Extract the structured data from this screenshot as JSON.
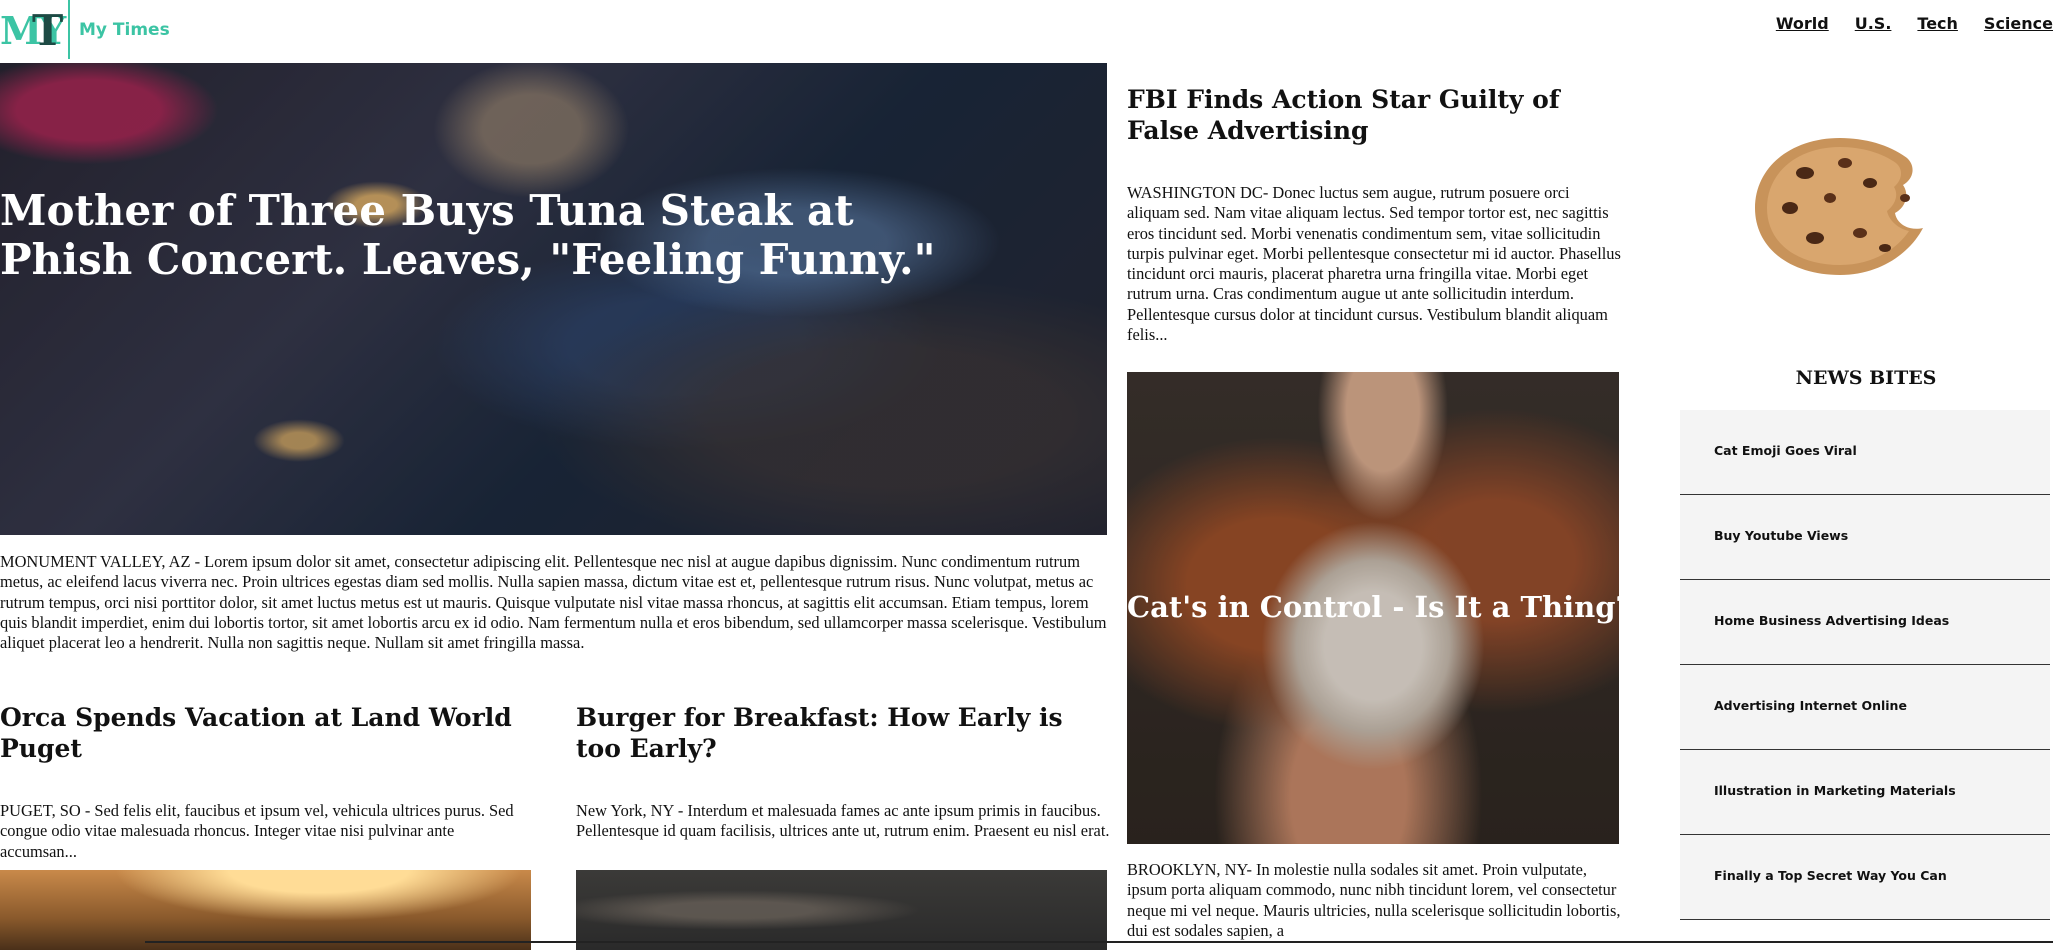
{
  "header": {
    "logo_text_m": "MY",
    "logo_text_t": "T",
    "site_name": "My Times",
    "nav": [
      "World",
      "U.S.",
      "Tech",
      "Science"
    ]
  },
  "hero": {
    "title": "Mother of Three Buys Tuna Steak at Phish Concert. Leaves, \"Feeling Funny.\"",
    "body": "MONUMENT VALLEY, AZ - Lorem ipsum dolor sit amet, consectetur adipiscing elit. Pellentesque nec nisl at augue dapibus dignissim. Nunc condimentum rutrum metus, ac eleifend lacus viverra nec. Proin ultrices egestas diam sed mollis. Nulla sapien massa, dictum vitae est et, pellentesque rutrum risus. Nunc volutpat, metus ac rutrum tempus, orci nisi porttitor dolor, sit amet luctus metus est ut mauris. Quisque vulputate nisl vitae massa rhoncus, at sagittis elit accumsan. Etiam tempus, lorem quis blandit imperdiet, enim dui lobortis tortor, sit amet lobortis arcu ex id odio. Nam fermentum nulla et eros bibendum, sed ullamcorper massa scelerisque. Vestibulum aliquet placerat leo a hendrerit. Nulla non sagittis neque. Nullam sit amet fringilla massa."
  },
  "articles": [
    {
      "title": "Orca Spends Vacation at Land World Puget",
      "body": "PUGET, SO - Sed felis elit, faucibus et ipsum vel, vehicula ultrices purus. Sed congue odio vitae malesuada rhoncus. Integer vitae nisi pulvinar ante accumsan..."
    },
    {
      "title": "Burger for Breakfast: How Early is too Early?",
      "body": "New York, NY - Interdum et malesuada fames ac ante ipsum primis in faucibus. Pellentesque id quam facilisis, ultrices ante ut, rutrum enim. Praesent eu nisl erat."
    }
  ],
  "middle": {
    "title": "FBI Finds Action Star Guilty of False Advertising",
    "body": "WASHINGTON DC- Donec luctus sem augue, rutrum posuere orci aliquam sed. Nam vitae aliquam lectus. Sed tempor tortor est, nec sagittis eros tincidunt sed. Morbi venenatis condimentum sem, vitae sollicitudin turpis pulvinar eget. Morbi pellentesque consectetur mi id auctor. Phasellus tincidunt orci mauris, placerat pharetra urna fringilla vitae. Morbi eget rutrum urna. Cras condimentum augue ut ante sollicitudin interdum. Pellentesque cursus dolor at tincidunt cursus. Vestibulum blandit aliquam felis...",
    "feature_title": "Cat's in Control - Is It a Thing?",
    "feature_body": "BROOKLYN, NY- In molestie nulla sodales sit amet. Proin vulputate, ipsum porta aliquam commodo, nunc nibh tincidunt lorem, vel consectetur neque mi vel neque. Mauris ultricies, nulla scelerisque sollicitudin lobortis, dui est sodales sapien, a"
  },
  "sidebar": {
    "heading": "NEWS BITES",
    "items": [
      "Cat Emoji Goes Viral",
      "Buy Youtube Views",
      "Home Business Advertising Ideas",
      "Advertising Internet Online",
      "Illustration in Marketing Materials",
      "Finally a Top Secret Way You Can"
    ]
  },
  "colors": {
    "brand_teal": "#3cc4a4",
    "brand_dark": "#1d4a44",
    "sidebar_bg": "#f4f4f4"
  }
}
